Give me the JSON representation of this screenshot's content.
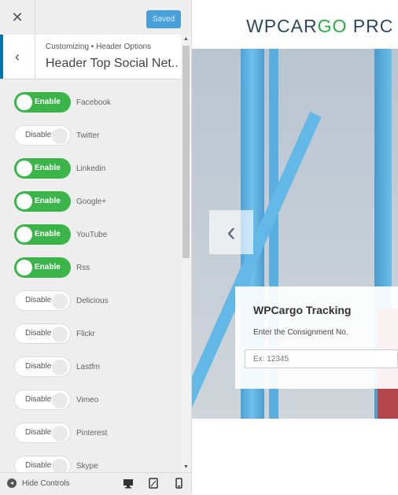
{
  "header": {
    "close_icon": "close-icon",
    "saved_label": "Saved"
  },
  "section": {
    "breadcrumb": "Customizing ▸ Header Options",
    "breadcrumb_display": "Customizing • Header Options",
    "title": "Header Top Social Net..."
  },
  "toggles": [
    {
      "state": "Enable",
      "name": "Facebook"
    },
    {
      "state": "Disable",
      "name": "Twitter"
    },
    {
      "state": "Enable",
      "name": "Linkedin"
    },
    {
      "state": "Enable",
      "name": "Google+"
    },
    {
      "state": "Enable",
      "name": "YouTube"
    },
    {
      "state": "Enable",
      "name": "Rss"
    },
    {
      "state": "Disable",
      "name": "Delicious"
    },
    {
      "state": "Disable",
      "name": "Flickr"
    },
    {
      "state": "Disable",
      "name": "Lastfm"
    },
    {
      "state": "Disable",
      "name": "Vimeo"
    },
    {
      "state": "Disable",
      "name": "Pinterest"
    },
    {
      "state": "Disable",
      "name": "Skype"
    }
  ],
  "footer": {
    "hide_controls": "Hide Controls",
    "devices": [
      "desktop-icon",
      "tablet-icon",
      "mobile-icon"
    ]
  },
  "preview": {
    "logo_main": "WPCAR",
    "logo_accent": "GO",
    "logo_tail": " PRC",
    "tracking_title": "WPCargo Tracking",
    "tracking_label": "Enter the Consignment No.",
    "tracking_placeholder": "Ex: 12345"
  },
  "colors": {
    "toggle_on": "#3bb54a",
    "saved_button": "#4aa0d8",
    "logo_dark": "#2e4a5c",
    "logo_accent": "#2dab48"
  }
}
